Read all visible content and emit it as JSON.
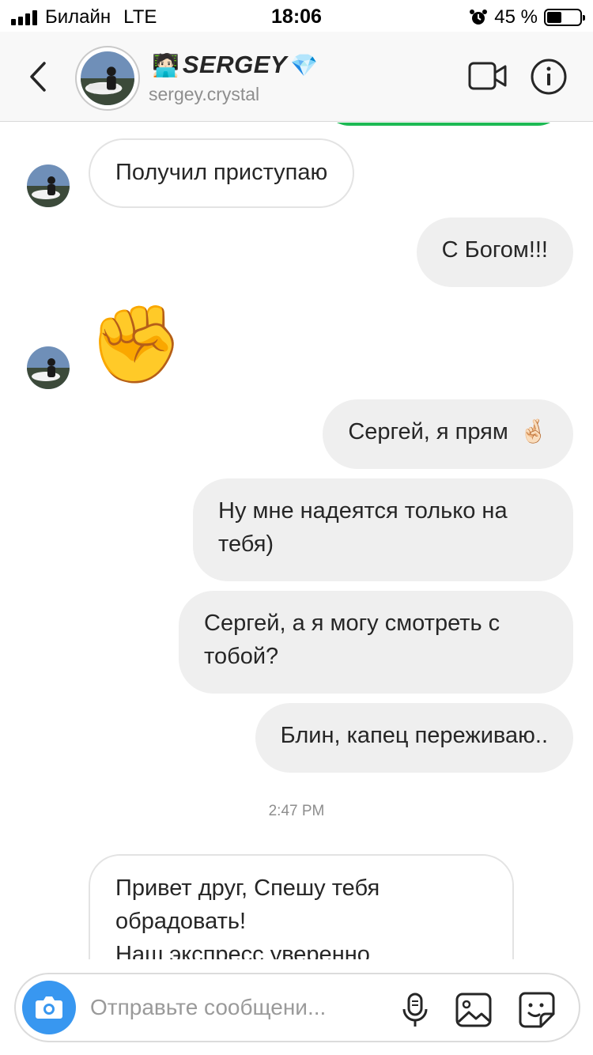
{
  "status": {
    "carrier": "Билайн",
    "network": "LTE",
    "time": "18:06",
    "battery_text": "45 %",
    "battery_level": 0.45
  },
  "header": {
    "name_emoji": "🧑🏻‍💻",
    "name": "SERGEY",
    "name_badge": "💎",
    "username": "sergey.crystal"
  },
  "messages": [
    {
      "side": "in",
      "text": "Получил приступаю"
    },
    {
      "side": "out",
      "text": "С Богом!!!"
    },
    {
      "side": "in",
      "emoji": "✊"
    },
    {
      "side": "out",
      "text": "Сергей, я прям",
      "emoji": "🤞🏻"
    },
    {
      "side": "out",
      "text": "Ну мне надеятся только на тебя)"
    },
    {
      "side": "out",
      "text": "Сергей, а я могу смотреть с тобой?"
    },
    {
      "side": "out",
      "text": "Блин, капец переживаю.."
    },
    {
      "side": "in",
      "lines": [
        "Привет друг, Спешу тебя",
        "обрадовать!",
        "Наш экспресс уверенно"
      ]
    }
  ],
  "timestamp": "2:47 PM",
  "composer": {
    "placeholder": "Отправьте сообщени..."
  },
  "colors": {
    "accent": "#3897f0",
    "green": "#1db954",
    "bubble_out": "#efefef"
  }
}
